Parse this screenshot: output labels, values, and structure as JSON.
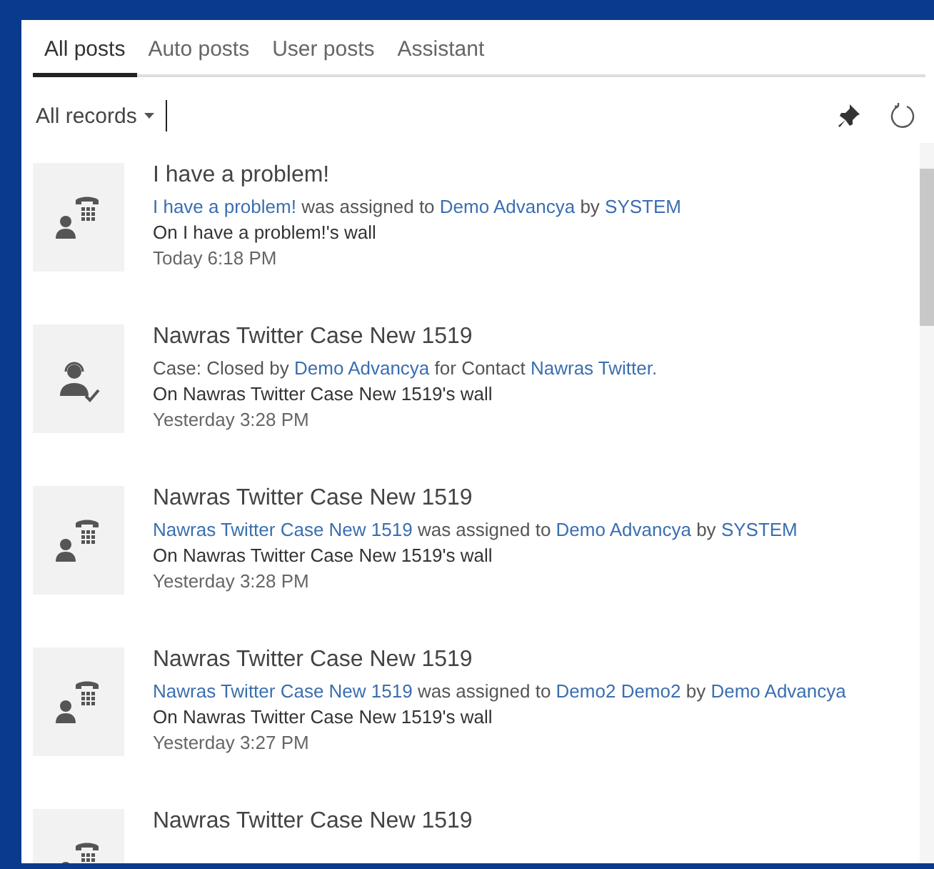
{
  "tabs": [
    {
      "label": "All posts",
      "selected": true
    },
    {
      "label": "Auto posts",
      "selected": false
    },
    {
      "label": "User posts",
      "selected": false
    },
    {
      "label": "Assistant",
      "selected": false
    }
  ],
  "filter": {
    "label": "All records"
  },
  "posts": [
    {
      "kind": "phone",
      "title": "I have a problem!",
      "message": [
        {
          "text": "I have a problem!",
          "link": true
        },
        {
          "text": " was assigned to ",
          "link": false
        },
        {
          "text": "Demo Advancya",
          "link": true
        },
        {
          "text": " by ",
          "link": false
        },
        {
          "text": "SYSTEM",
          "link": true
        }
      ],
      "wall": "On I have a problem!'s wall",
      "time": "Today 6:18 PM"
    },
    {
      "kind": "agent",
      "title": "Nawras Twitter Case New 1519",
      "message": [
        {
          "text": "Case: Closed by ",
          "link": false
        },
        {
          "text": "Demo Advancya",
          "link": true
        },
        {
          "text": " for Contact ",
          "link": false
        },
        {
          "text": "Nawras Twitter.",
          "link": true
        }
      ],
      "wall": "On Nawras Twitter Case New 1519's wall",
      "time": "Yesterday 3:28 PM"
    },
    {
      "kind": "phone",
      "title": "Nawras Twitter Case New 1519",
      "message": [
        {
          "text": "Nawras Twitter Case New 1519",
          "link": true
        },
        {
          "text": " was assigned to ",
          "link": false
        },
        {
          "text": "Demo Advancya",
          "link": true
        },
        {
          "text": " by ",
          "link": false
        },
        {
          "text": "SYSTEM",
          "link": true
        }
      ],
      "wall": "On Nawras Twitter Case New 1519's wall",
      "time": "Yesterday 3:28 PM"
    },
    {
      "kind": "phone",
      "title": "Nawras Twitter Case New 1519",
      "message": [
        {
          "text": "Nawras Twitter Case New 1519",
          "link": true
        },
        {
          "text": " was assigned to ",
          "link": false
        },
        {
          "text": "Demo2 Demo2",
          "link": true
        },
        {
          "text": " by ",
          "link": false
        },
        {
          "text": "Demo Advancya",
          "link": true
        }
      ],
      "wall": "On Nawras Twitter Case New 1519's wall",
      "time": "Yesterday 3:27 PM"
    },
    {
      "kind": "phone",
      "title": "Nawras Twitter Case New 1519"
    }
  ]
}
